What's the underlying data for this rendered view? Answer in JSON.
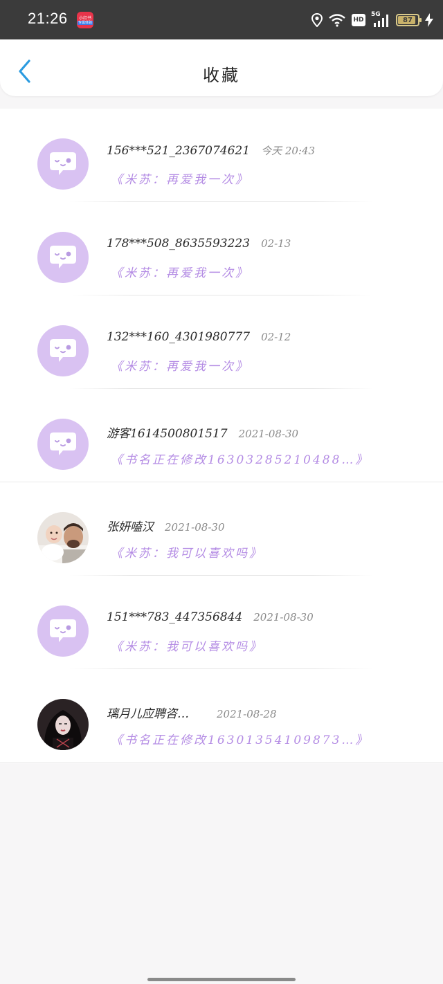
{
  "status_bar": {
    "time": "21:26",
    "app_badge_line1": "小红书",
    "app_badge_line2": "专属体验",
    "network": "5G",
    "battery": "87",
    "icons": [
      "location-icon",
      "wifi-icon",
      "hd-icon",
      "signal-icon",
      "battery-icon",
      "charging-icon"
    ]
  },
  "header": {
    "title": "收藏",
    "back_icon": "chevron-left-icon",
    "accent": "#2b9be0"
  },
  "favorites": [
    {
      "name": "156***521_2367074621",
      "date": "今天 20:43",
      "book": "《米苏：再爱我一次》",
      "avatar": "default-bubble"
    },
    {
      "name": "178***508_8635593223",
      "date": "02-13",
      "book": "《米苏：再爱我一次》",
      "avatar": "default-bubble"
    },
    {
      "name": "132***160_4301980777",
      "date": "02-12",
      "book": "《米苏：再爱我一次》",
      "avatar": "default-bubble"
    },
    {
      "name": "游客1614500801517",
      "date": "2021-08-30",
      "book": "《书名正在修改16303285210488…》",
      "avatar": "default-bubble"
    },
    {
      "name": "张妍嗑汉",
      "date": "2021-08-30",
      "book": "《米苏：我可以喜欢吗》",
      "avatar": "photo-baby-man"
    },
    {
      "name": "151***783_447356844",
      "date": "2021-08-30",
      "book": "《米苏：我可以喜欢吗》",
      "avatar": "default-bubble"
    },
    {
      "name": "璃月儿应聘咨…",
      "date": "2021-08-28",
      "book": "《书名正在修改16301354109873…》",
      "avatar": "photo-dark-hair"
    }
  ],
  "colors": {
    "avatar_bg": "#d9c2f2",
    "book_text": "#b48ce4",
    "date_text": "#8a8a8a"
  }
}
